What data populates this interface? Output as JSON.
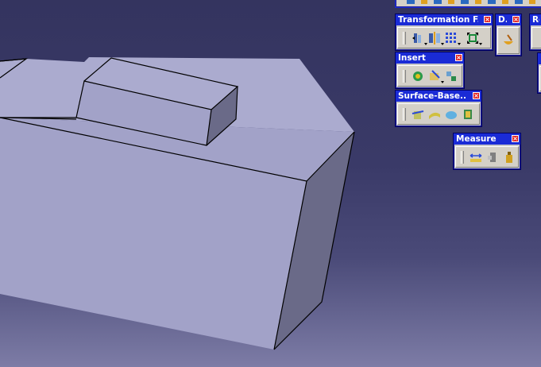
{
  "toolbars": {
    "transformation": {
      "title": "Transformation F...",
      "icons": [
        "translation-icon",
        "symmetry-icon",
        "pattern-icon",
        "scaling-icon"
      ]
    },
    "d": {
      "title": "D...",
      "icons": [
        "draft-analysis-icon"
      ]
    },
    "re": {
      "title": "Re"
    },
    "insert": {
      "title": "Insert",
      "icons": [
        "body-icon",
        "sketch-icon",
        "geometrical-set-icon"
      ]
    },
    "surface": {
      "title": "Surface-Base...",
      "icons": [
        "split-icon",
        "thick-surface-icon",
        "close-surface-icon",
        "sew-surface-icon"
      ]
    },
    "measure": {
      "title": "Measure",
      "icons": [
        "measure-between-icon",
        "measure-item-icon",
        "measure-inertia-icon"
      ]
    }
  },
  "colors": {
    "titlebar": "#1a2bd6",
    "close": "#e02020",
    "part_face_front": "#a2a2c8",
    "part_face_top": "#ababcf",
    "part_face_side": "#6a6a88"
  }
}
